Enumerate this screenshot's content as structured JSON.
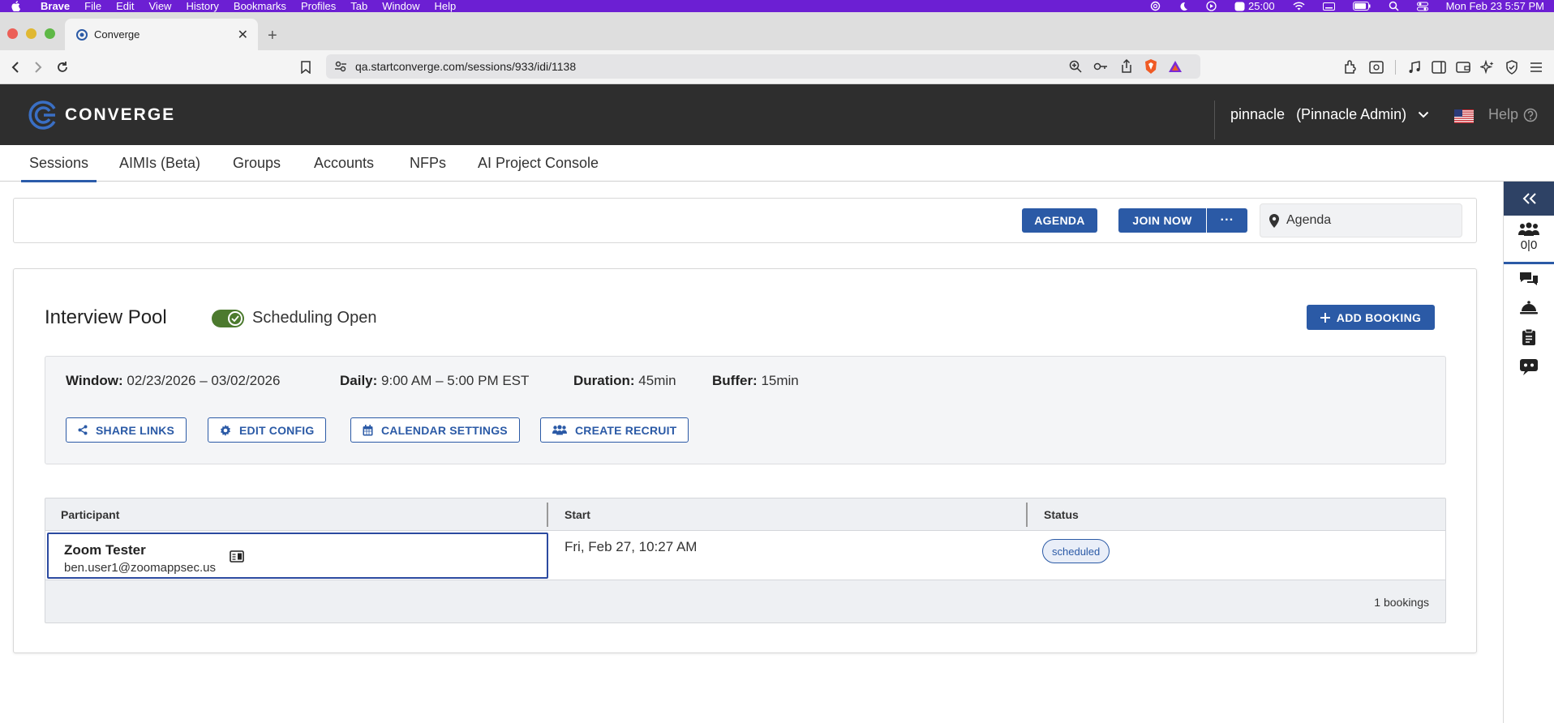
{
  "menubar": {
    "app": "Brave",
    "items": [
      "File",
      "Edit",
      "View",
      "History",
      "Bookmarks",
      "Profiles",
      "Tab",
      "Window",
      "Help"
    ],
    "timer": "25:00",
    "datetime": "Mon Feb 23  5:57 PM"
  },
  "browser": {
    "tab_title": "Converge",
    "url": "qa.startconverge.com/sessions/933/idi/1138"
  },
  "header": {
    "logo_text": "CONVERGE",
    "user": "pinnacle",
    "role": "(Pinnacle Admin)",
    "help": "Help"
  },
  "nav": {
    "tabs": [
      "Sessions",
      "AIMIs (Beta)",
      "Groups",
      "Accounts",
      "NFPs",
      "AI Project Console"
    ],
    "active": "Sessions"
  },
  "actions": {
    "agenda": "AGENDA",
    "join_now": "JOIN NOW",
    "more": "···",
    "location": "Agenda"
  },
  "rail": {
    "counter": "0|0"
  },
  "pool": {
    "title": "Interview Pool",
    "scheduling_label": "Scheduling Open",
    "scheduling_open": true,
    "add_booking": "ADD BOOKING",
    "config": {
      "window_label": "Window:",
      "window_value": "02/23/2026 – 03/02/2026",
      "daily_label": "Daily:",
      "daily_value": "9:00 AM – 5:00 PM EST",
      "duration_label": "Duration:",
      "duration_value": "45min",
      "buffer_label": "Buffer:",
      "buffer_value": "15min"
    },
    "buttons": {
      "share_links": "SHARE LINKS",
      "edit_config": "EDIT CONFIG",
      "calendar_settings": "CALENDAR SETTINGS",
      "create_recruit": "CREATE RECRUIT"
    }
  },
  "table": {
    "columns": [
      "Participant",
      "Start",
      "Status"
    ],
    "rows": [
      {
        "name": "Zoom Tester",
        "email": "ben.user1@zoomappsec.us",
        "start": "Fri, Feb 27, 10:27 AM",
        "status": "scheduled"
      }
    ],
    "footer": "1 bookings"
  },
  "colors": {
    "menubar": "#6c1fd3",
    "header_bg": "#2e2e2e",
    "primary": "#2b5aa6",
    "toggle_on": "#4c7a2e",
    "rail_collapse": "#2e4265"
  }
}
